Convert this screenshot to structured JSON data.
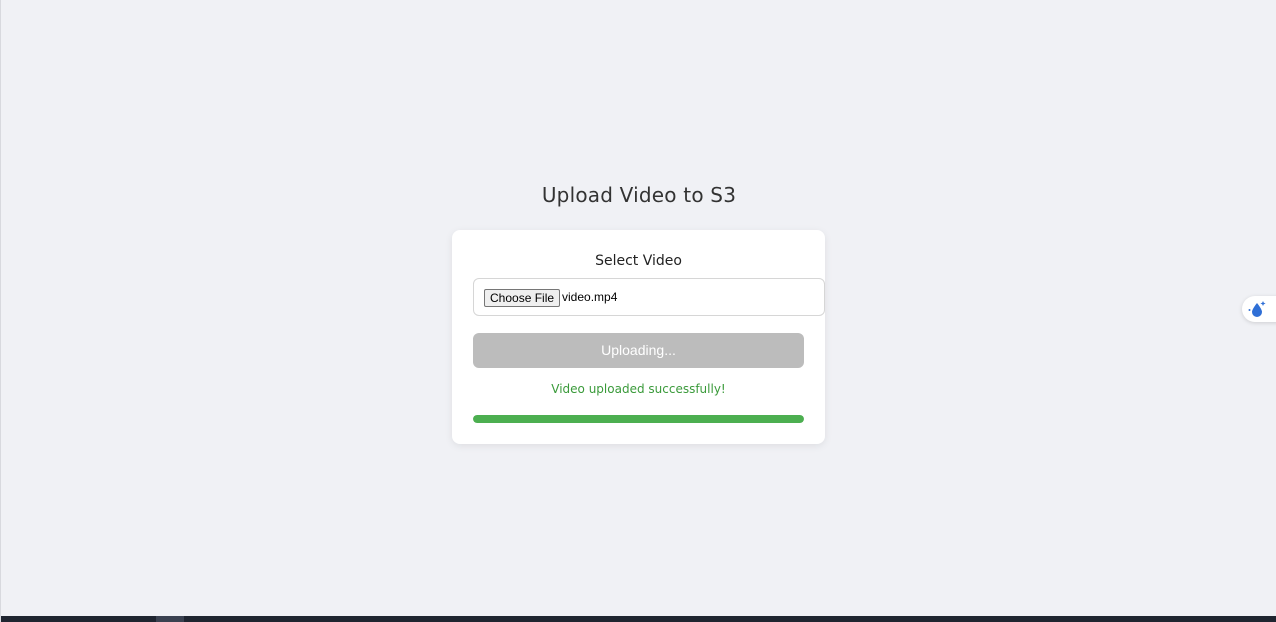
{
  "page": {
    "title": "Upload Video to S3"
  },
  "form": {
    "select_label": "Select Video",
    "choose_file_label": "Choose File",
    "file_name": "video.mp4",
    "upload_button_label": "Uploading...",
    "status_message": "Video uploaded successfully!",
    "progress_percent": 100
  },
  "widget": {
    "icon": "droplet-sparkle-icon"
  },
  "colors": {
    "background": "#f0f1f5",
    "success": "#3a9a3a",
    "progress": "#4caf50",
    "button_disabled": "#bcbcbc"
  }
}
